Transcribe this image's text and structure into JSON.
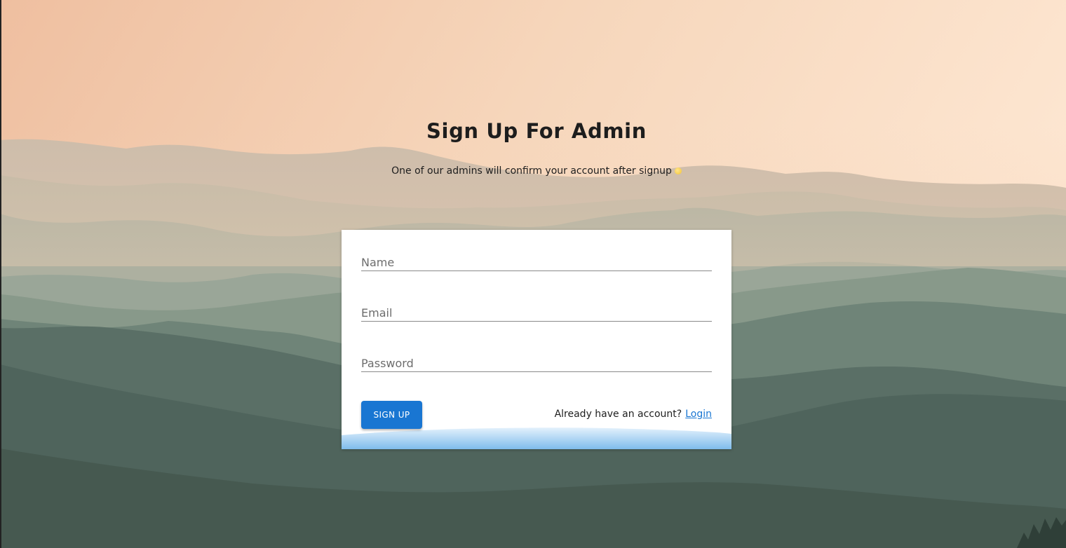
{
  "page": {
    "title": "Sign Up For Admin",
    "subtitle": "One of our admins will confirm your account after signup"
  },
  "form": {
    "name_placeholder": "Name",
    "email_placeholder": "Email",
    "password_placeholder": "Password",
    "name_value": "",
    "email_value": "",
    "password_value": "",
    "submit_label": "SIGN UP",
    "account_prompt": "Already have an account?",
    "login_link": "Login"
  },
  "colors": {
    "primary": "#1976d2",
    "card_background": "#ffffff",
    "sky_top": "#f3c4a2",
    "mountains_dark": "#4a5f58"
  },
  "icons": {
    "subtitle_emoji": "sparkle-icon"
  }
}
